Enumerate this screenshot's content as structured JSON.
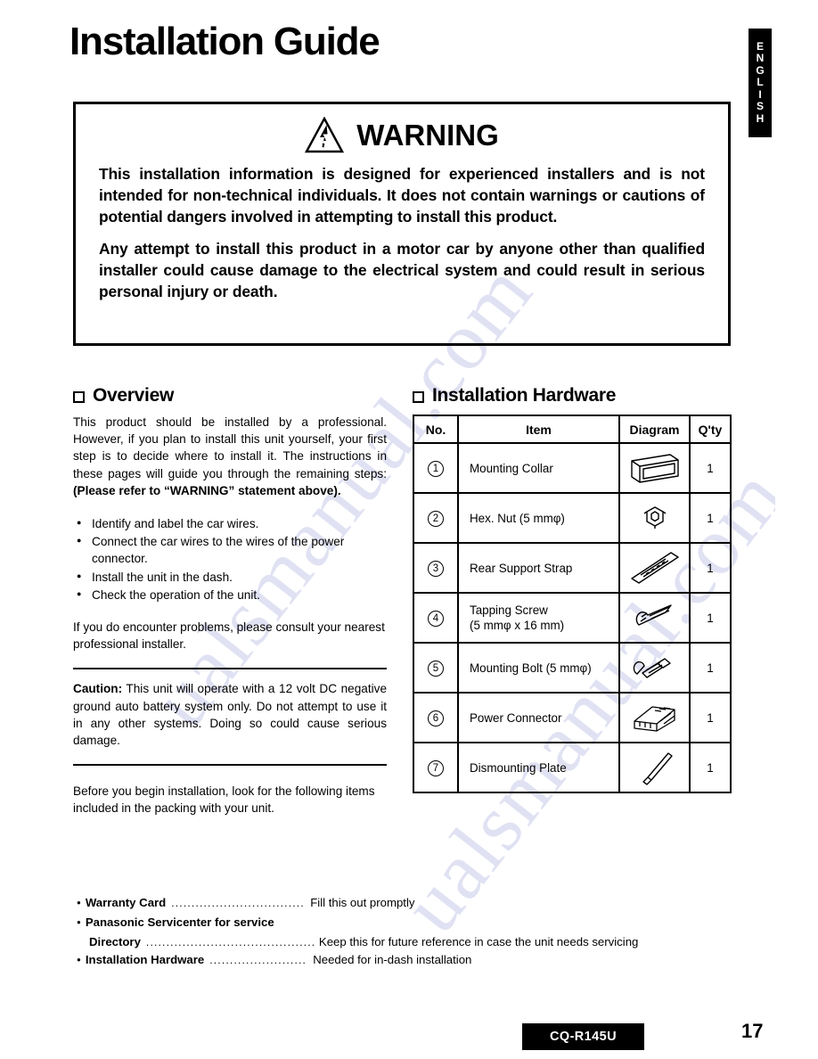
{
  "page": {
    "title": "Installation Guide",
    "language_tab": "ENGLISH",
    "model": "CQ-R145U",
    "page_number": "17"
  },
  "warning": {
    "icon": "warning-lightning-triangle-icon",
    "heading": "WARNING",
    "paragraph1": "This installation information is designed for experienced installers and is not intended for non-technical individuals. It does not contain warnings or cautions of potential dangers involved in attempting to install this product.",
    "paragraph2": "Any attempt to install this product in a motor car by anyone other than qualified installer could cause damage to the electrical system and could result in serious personal injury or death."
  },
  "overview": {
    "heading": "Overview",
    "intro_normal": "This product should be installed by a professional. However, if you plan to install this unit yourself, your first step is to decide where to install it. The instructions in these pages will guide you through the remaining steps: ",
    "intro_bold": "(Please refer to “WARNING” statement above).",
    "steps": [
      "Identify and label the car wires.",
      "Connect the car wires to the wires of the power connector.",
      "Install the unit in the dash.",
      "Check the operation of the unit."
    ],
    "follow_up": "If you do encounter problems, please consult your nearest professional installer.",
    "caution_label": "Caution:",
    "caution_text": " This unit will operate with a 12 volt DC negative ground auto battery system only. Do not attempt to use it in any other systems. Doing so could cause serious damage.",
    "before_begin": "Before you begin installation, look for the following items included in the packing with your unit."
  },
  "hardware": {
    "heading": "Installation Hardware",
    "columns": [
      "No.",
      "Item",
      "Diagram",
      "Q'ty"
    ],
    "rows": [
      {
        "no": "1",
        "item": "Mounting Collar",
        "diagram": "mounting-collar-icon",
        "qty": "1"
      },
      {
        "no": "2",
        "item": "Hex. Nut (5 mmφ)",
        "diagram": "hex-nut-icon",
        "qty": "1"
      },
      {
        "no": "3",
        "item": "Rear Support Strap",
        "diagram": "rear-support-strap-icon",
        "qty": "1"
      },
      {
        "no": "4",
        "item": "Tapping Screw\n(5 mmφ x 16 mm)",
        "item_line1": "Tapping Screw",
        "item_line2": "(5 mmφ x 16 mm)",
        "diagram": "tapping-screw-icon",
        "qty": "1"
      },
      {
        "no": "5",
        "item": "Mounting Bolt (5 mmφ)",
        "diagram": "mounting-bolt-icon",
        "qty": "1"
      },
      {
        "no": "6",
        "item": "Power Connector",
        "diagram": "power-connector-icon",
        "qty": "1"
      },
      {
        "no": "7",
        "item": "Dismounting Plate",
        "diagram": "dismounting-plate-icon",
        "qty": "1"
      }
    ]
  },
  "packing_list": [
    {
      "name": "Warranty Card",
      "dots": "......................................",
      "description": "Fill this out promptly",
      "second_line": false
    },
    {
      "name": "Panasonic Servicenter for service",
      "continuation_name": "Directory",
      "dots": "..............................................",
      "description": "Keep this for future reference in case the unit needs servicing",
      "second_line": true
    },
    {
      "name": "Installation Hardware",
      "dots": "........................",
      "description": "Needed for in-dash installation",
      "second_line": false
    }
  ],
  "colors": {
    "ink": "#000000",
    "paper": "#ffffff",
    "watermark": "#9aa3d8"
  },
  "watermark_text": "ualsmanual.com"
}
